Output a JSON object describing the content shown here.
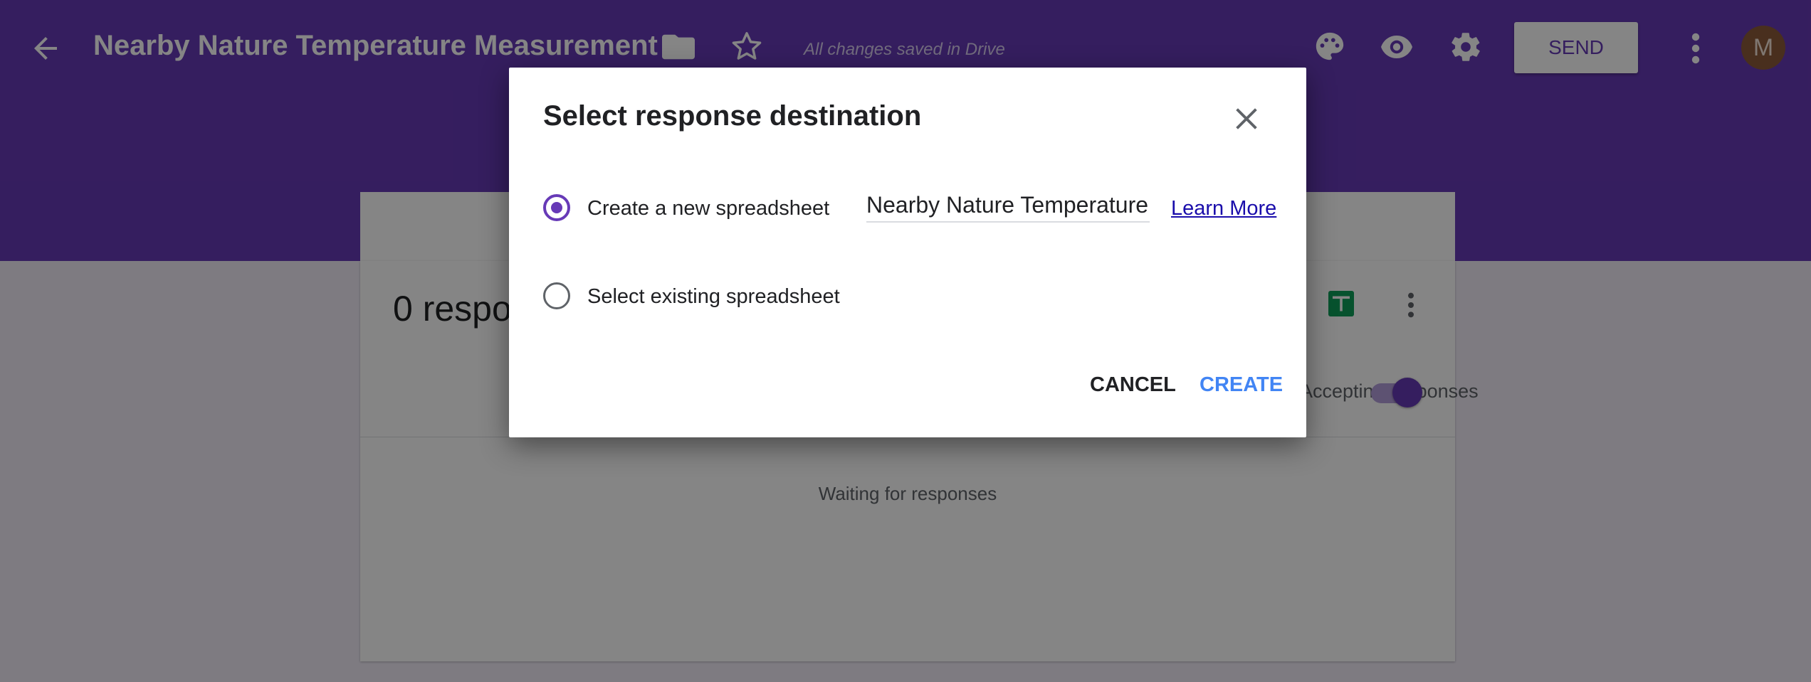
{
  "header": {
    "title": "Nearby Nature Temperature Measurement",
    "save_status": "All changes saved in Drive",
    "send_label": "SEND",
    "avatar_letter": "M",
    "color": "#673ab7"
  },
  "responses": {
    "count_label": "0 responses",
    "accepting_label": "Accepting responses",
    "accepting": true,
    "waiting_text": "Waiting for responses"
  },
  "dialog": {
    "title": "Select response destination",
    "options": [
      {
        "label": "Create a new spreadsheet",
        "selected": true
      },
      {
        "label": "Select existing spreadsheet",
        "selected": false
      }
    ],
    "spreadsheet_name": "Nearby Nature Temperature",
    "learn_more": "Learn More",
    "cancel_label": "CANCEL",
    "create_label": "CREATE"
  },
  "icons": {
    "back": "arrow-back-icon",
    "folder": "folder-icon",
    "star": "star-icon",
    "palette": "palette-icon",
    "preview": "eye-icon",
    "settings": "gear-icon",
    "more": "more-vert-icon",
    "sheets": "sheets-icon",
    "close": "close-icon"
  }
}
